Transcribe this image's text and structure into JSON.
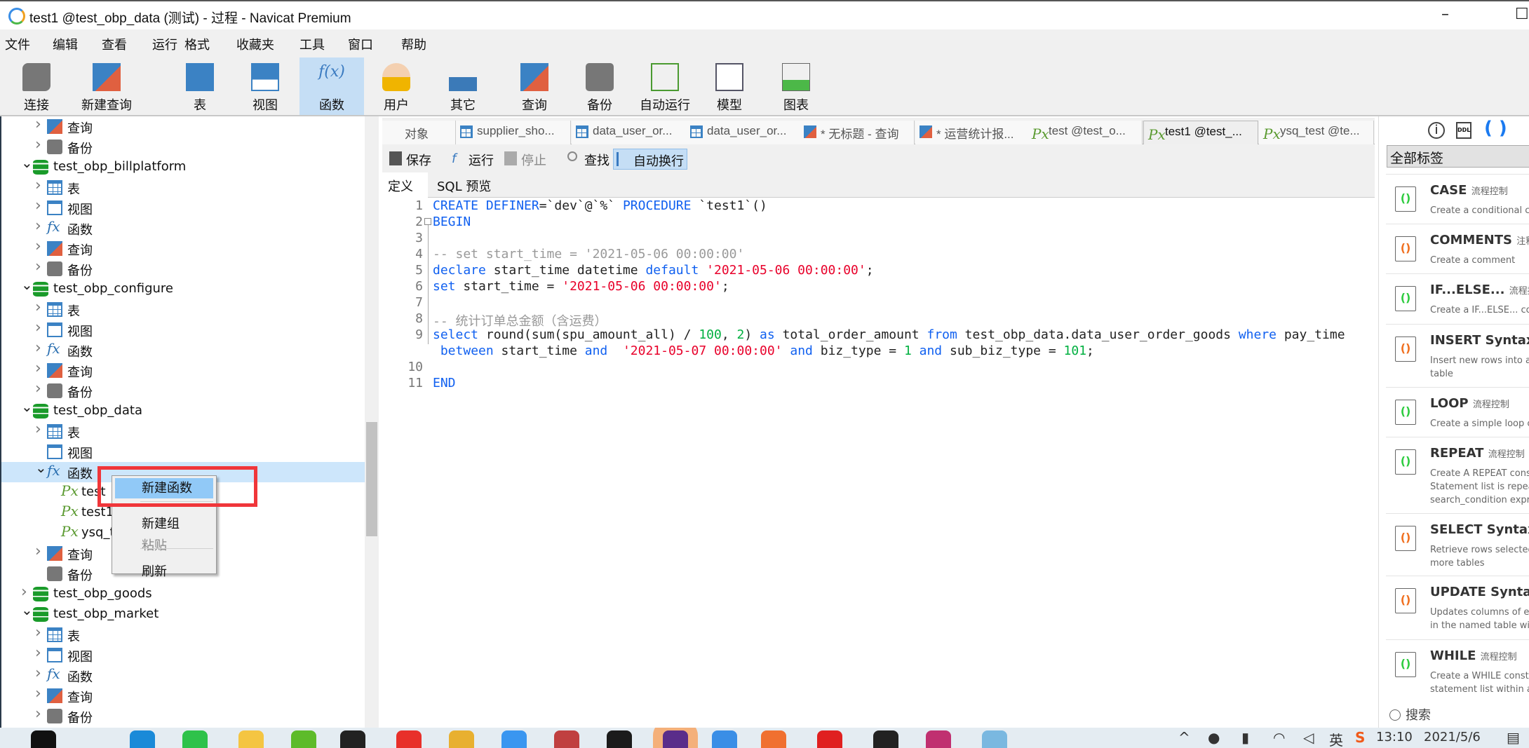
{
  "window": {
    "title": "test1 @test_obp_data (测试) - 过程 - Navicat Premium",
    "minimize": "–",
    "maximize": "☐"
  },
  "menu": [
    "文件",
    "编辑",
    "查看",
    "运行",
    "格式",
    "收藏夹",
    "工具",
    "窗口",
    "帮助"
  ],
  "toolbar": [
    {
      "label": "连接",
      "icon": "plug-icon"
    },
    {
      "label": "新建查询",
      "icon": "new-query-icon"
    },
    {
      "label": "表",
      "icon": "table-icon"
    },
    {
      "label": "视图",
      "icon": "view-icon"
    },
    {
      "label": "函数",
      "icon": "function-icon",
      "active": true
    },
    {
      "label": "用户",
      "icon": "user-icon"
    },
    {
      "label": "其它",
      "icon": "tools-icon"
    },
    {
      "label": "查询",
      "icon": "query-icon"
    },
    {
      "label": "备份",
      "icon": "backup-icon"
    },
    {
      "label": "自动运行",
      "icon": "schedule-icon"
    },
    {
      "label": "模型",
      "icon": "model-icon"
    },
    {
      "label": "图表",
      "icon": "chart-icon"
    }
  ],
  "tree": [
    {
      "d": 1,
      "t": "查询",
      "i": "query",
      "c": ">"
    },
    {
      "d": 1,
      "t": "备份",
      "i": "backup",
      "c": ">"
    },
    {
      "d": 0,
      "t": "test_obp_billplatform",
      "i": "db",
      "c": "v"
    },
    {
      "d": 1,
      "t": "表",
      "i": "table",
      "c": ">"
    },
    {
      "d": 1,
      "t": "视图",
      "i": "view",
      "c": ">"
    },
    {
      "d": 1,
      "t": "函数",
      "i": "fx",
      "c": ">"
    },
    {
      "d": 1,
      "t": "查询",
      "i": "query",
      "c": ">"
    },
    {
      "d": 1,
      "t": "备份",
      "i": "backup",
      "c": ">"
    },
    {
      "d": 0,
      "t": "test_obp_configure",
      "i": "db",
      "c": "v"
    },
    {
      "d": 1,
      "t": "表",
      "i": "table",
      "c": ">"
    },
    {
      "d": 1,
      "t": "视图",
      "i": "view",
      "c": ">"
    },
    {
      "d": 1,
      "t": "函数",
      "i": "fx",
      "c": ">"
    },
    {
      "d": 1,
      "t": "查询",
      "i": "query",
      "c": ">"
    },
    {
      "d": 1,
      "t": "备份",
      "i": "backup",
      "c": ">"
    },
    {
      "d": 0,
      "t": "test_obp_data",
      "i": "db",
      "c": "v"
    },
    {
      "d": 1,
      "t": "表",
      "i": "table",
      "c": ">"
    },
    {
      "d": 1,
      "t": "视图",
      "i": "view",
      "c": ""
    },
    {
      "d": 1,
      "t": "函数",
      "i": "fx",
      "c": "v",
      "sel": true
    },
    {
      "d": 2,
      "t": "test",
      "i": "px",
      "c": ""
    },
    {
      "d": 2,
      "t": "test1",
      "i": "px",
      "c": ""
    },
    {
      "d": 2,
      "t": "ysq_test",
      "i": "px",
      "c": ""
    },
    {
      "d": 1,
      "t": "查询",
      "i": "query",
      "c": ">"
    },
    {
      "d": 1,
      "t": "备份",
      "i": "backup",
      "c": ""
    },
    {
      "d": 0,
      "t": "test_obp_goods",
      "i": "db",
      "c": ">"
    },
    {
      "d": 0,
      "t": "test_obp_market",
      "i": "db",
      "c": "v"
    },
    {
      "d": 1,
      "t": "表",
      "i": "table",
      "c": ">"
    },
    {
      "d": 1,
      "t": "视图",
      "i": "view",
      "c": ">"
    },
    {
      "d": 1,
      "t": "函数",
      "i": "fx",
      "c": ">"
    },
    {
      "d": 1,
      "t": "查询",
      "i": "query",
      "c": ">"
    },
    {
      "d": 1,
      "t": "备份",
      "i": "backup",
      "c": ">"
    }
  ],
  "context_menu": {
    "items": [
      {
        "label": "新建函数",
        "highlighted": true
      },
      {
        "label": "新建组"
      },
      {
        "label": "粘贴",
        "disabled": true
      },
      {
        "label": "刷新"
      }
    ],
    "highlight_color": "#f0363a"
  },
  "tabs": [
    {
      "label": "对象",
      "i": ""
    },
    {
      "label": "supplier_sho...",
      "i": "table"
    },
    {
      "label": "data_user_or...",
      "i": "table"
    },
    {
      "label": "data_user_or...",
      "i": "table"
    },
    {
      "label": "* 无标题 - 查询",
      "i": "query"
    },
    {
      "label": "* 运营统计报...",
      "i": "query"
    },
    {
      "label": "test @test_o...",
      "i": "px"
    },
    {
      "label": "test1 @test_...",
      "i": "px",
      "active": true
    },
    {
      "label": "ysq_test @te...",
      "i": "px"
    }
  ],
  "editor_toolbar": [
    {
      "label": "保存",
      "icon": "save-icon"
    },
    {
      "label": "运行",
      "icon": "run-icon"
    },
    {
      "label": "停止",
      "icon": "stop-icon",
      "disabled": true
    },
    {
      "label": "查找",
      "icon": "search-icon"
    },
    {
      "label": "自动换行",
      "icon": "wrap-icon",
      "active": true
    }
  ],
  "subtabs": [
    {
      "label": "定义",
      "active": true
    },
    {
      "label": "SQL 预览"
    }
  ],
  "code": [
    {
      "n": "1",
      "tok": [
        [
          "kw",
          "CREATE DEFINER"
        ],
        [
          "",
          "=`dev`@`%` "
        ],
        [
          "kw",
          "PROCEDURE"
        ],
        [
          "",
          " `test1`()"
        ]
      ]
    },
    {
      "n": "2",
      "tok": [
        [
          "kw",
          "BEGIN"
        ]
      ]
    },
    {
      "n": "3",
      "tok": []
    },
    {
      "n": "4",
      "tok": [
        [
          "cm",
          "-- set start_time = '2021-05-06 00:00:00'"
        ]
      ]
    },
    {
      "n": "5",
      "tok": [
        [
          "kw",
          "declare"
        ],
        [
          "",
          " start_time datetime "
        ],
        [
          "kw",
          "default"
        ],
        [
          "",
          " "
        ],
        [
          "str",
          "'2021-05-06 00:00:00'"
        ],
        [
          "",
          ";"
        ]
      ]
    },
    {
      "n": "6",
      "tok": [
        [
          "kw",
          "set"
        ],
        [
          "",
          " start_time = "
        ],
        [
          "str",
          "'2021-05-06 00:00:00'"
        ],
        [
          "",
          ";"
        ]
      ]
    },
    {
      "n": "7",
      "tok": []
    },
    {
      "n": "8",
      "tok": [
        [
          "cm",
          "-- 统计订单总金额（含运费）"
        ]
      ]
    },
    {
      "n": "9",
      "tok": [
        [
          "kw",
          "select"
        ],
        [
          "",
          " round(sum(spu_amount_all) / "
        ],
        [
          "num",
          "100"
        ],
        [
          "",
          ", "
        ],
        [
          "num",
          "2"
        ],
        [
          "",
          ") "
        ],
        [
          "kw",
          "as"
        ],
        [
          "",
          " total_order_amount "
        ],
        [
          "kw",
          "from"
        ],
        [
          "",
          " test_obp_data.data_user_order_goods "
        ],
        [
          "kw",
          "where"
        ],
        [
          "",
          " pay_time"
        ]
      ]
    },
    {
      "n": "",
      "tok": [
        [
          "",
          " "
        ],
        [
          "kw",
          "between"
        ],
        [
          "",
          " start_time "
        ],
        [
          "kw",
          "and"
        ],
        [
          "",
          "  "
        ],
        [
          "str",
          "'2021-05-07 00:00:00'"
        ],
        [
          "",
          " "
        ],
        [
          "kw",
          "and"
        ],
        [
          "",
          " biz_type = "
        ],
        [
          "num",
          "1"
        ],
        [
          "",
          " "
        ],
        [
          "kw",
          "and"
        ],
        [
          "",
          " sub_biz_type = "
        ],
        [
          "num",
          "101"
        ],
        [
          "",
          ";"
        ]
      ]
    },
    {
      "n": "10",
      "tok": []
    },
    {
      "n": "11",
      "tok": [
        [
          "kw",
          "END"
        ]
      ]
    }
  ],
  "right_panel": {
    "dropdown": "全部标签",
    "search": "搜索",
    "snippets": [
      {
        "name": "CASE",
        "tag": "流程控制",
        "desc": [
          "Create a conditional con"
        ],
        "kind": "flow"
      },
      {
        "name": "COMMENTS",
        "tag": "注释",
        "desc": [
          "Create a comment"
        ],
        "kind": "ddl"
      },
      {
        "name": "IF...ELSE...",
        "tag": "流程控制",
        "desc": [
          "Create a IF...ELSE... cons"
        ],
        "kind": "flow"
      },
      {
        "name": "INSERT Syntax",
        "tag": "D",
        "desc": [
          "Insert new rows into an",
          "table"
        ],
        "kind": "ddl"
      },
      {
        "name": "LOOP",
        "tag": "流程控制",
        "desc": [
          "Create a simple loop con"
        ],
        "kind": "flow"
      },
      {
        "name": "REPEAT",
        "tag": "流程控制",
        "desc": [
          "Create A REPEAT constr",
          "Statement list is repeate",
          "search_condition expres"
        ],
        "kind": "flow"
      },
      {
        "name": "SELECT Syntax",
        "tag": "DI",
        "desc": [
          "Retrieve rows selected fr",
          "more tables"
        ],
        "kind": "ddl"
      },
      {
        "name": "UPDATE Syntax",
        "tag": "",
        "desc": [
          "Updates columns of exis",
          "in the named table with"
        ],
        "kind": "ddl"
      },
      {
        "name": "WHILE",
        "tag": "流程控制",
        "desc": [
          "Create a WHILE constru",
          "statement list within a W"
        ],
        "kind": "flow"
      }
    ]
  },
  "taskbar": {
    "time": "13:10",
    "date": "2021/5/6",
    "ime": "英",
    "apps": [
      {
        "name": "start",
        "c": "#111"
      },
      {
        "name": "search",
        "c": "transparent"
      },
      {
        "name": "edge",
        "c": "#1a8ad8"
      },
      {
        "name": "wechat",
        "c": "#2ec24a"
      },
      {
        "name": "explorer",
        "c": "#f4c542"
      },
      {
        "name": "ie",
        "c": "#5dbb2a"
      },
      {
        "name": "figma",
        "c": "#222"
      },
      {
        "name": "wps",
        "c": "#e8302a"
      },
      {
        "name": "chrome",
        "c": "#e8b030"
      },
      {
        "name": "dingtalk",
        "c": "#3a96f0"
      },
      {
        "name": "app-grid",
        "c": "#c04040"
      },
      {
        "name": "pycharm",
        "c": "#1b1b1b"
      },
      {
        "name": "app-purple",
        "c": "#5a2d8a"
      },
      {
        "name": "navicat",
        "c": "#3a8ee6"
      },
      {
        "name": "app-orange",
        "c": "#f07030"
      },
      {
        "name": "netease-music",
        "c": "#e02020"
      },
      {
        "name": "terminal",
        "c": "#222"
      },
      {
        "name": "pen",
        "c": "#c03070"
      },
      {
        "name": "notepad",
        "c": "#7ab8e0"
      }
    ]
  }
}
